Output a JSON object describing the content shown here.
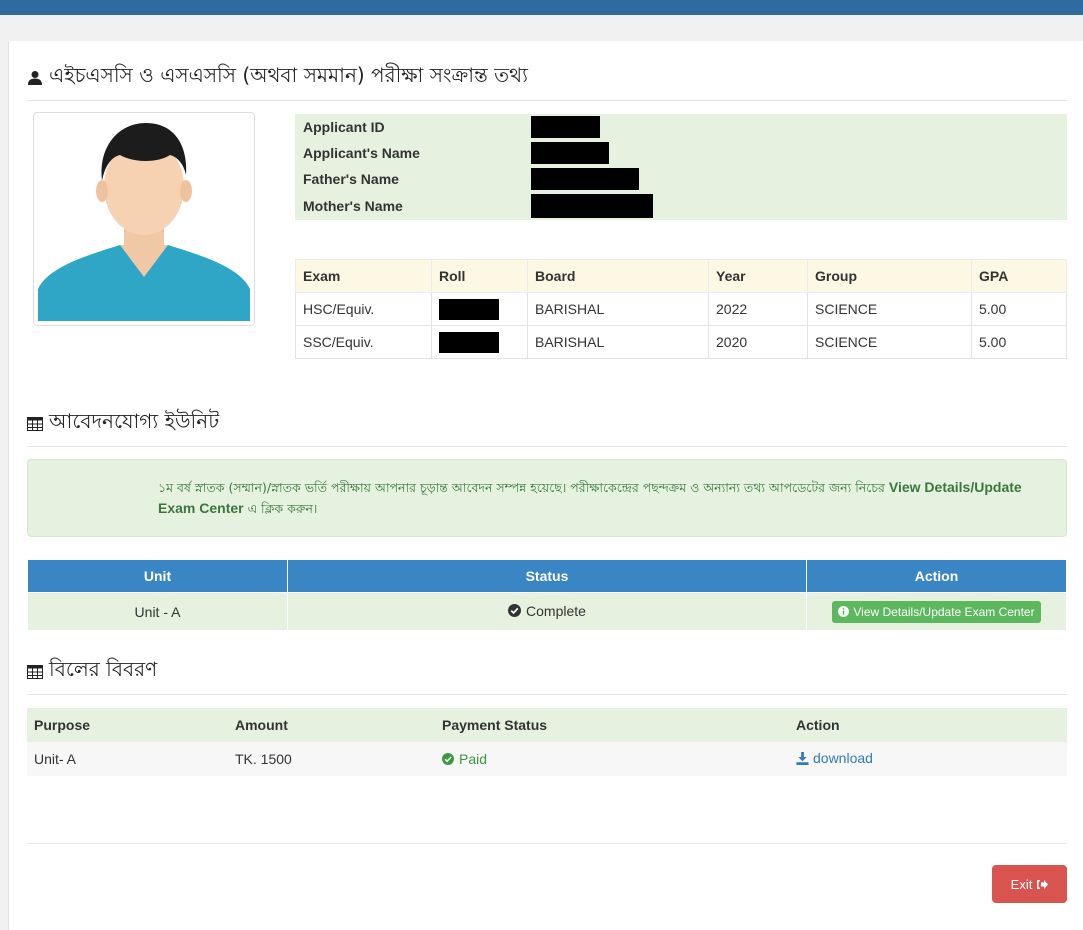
{
  "header": {
    "color": "#2f6aa0"
  },
  "sections": {
    "exam_info_title": "এইচএসসি ও এসএসসি (অথবা সমমান) পরীক্ষা সংক্রান্ত তথ্য",
    "units_title": "আবেদনযোগ্য ইউনিট",
    "bill_title": "বিলের বিবরণ"
  },
  "applicant": {
    "labels": {
      "id": "Applicant ID",
      "name": "Applicant's Name",
      "father": "Father's Name",
      "mother": "Mother's Name"
    }
  },
  "exam_table": {
    "headers": [
      "Exam",
      "Roll",
      "Board",
      "Year",
      "Group",
      "GPA"
    ],
    "rows": [
      {
        "exam": "HSC/Equiv.",
        "board": "BARISHAL",
        "year": "2022",
        "group": "SCIENCE",
        "gpa": "5.00"
      },
      {
        "exam": "SSC/Equiv.",
        "board": "BARISHAL",
        "year": "2020",
        "group": "SCIENCE",
        "gpa": "5.00"
      }
    ]
  },
  "alert": {
    "text_before": "১ম বর্ষ স্নাতক (সম্মান)/স্নাতক ভর্তি পরীক্ষায় আপনার চূড়ান্ত আবেদন সম্পন্ন হয়েছে। পরীক্ষাকেন্দ্রের পছন্দক্রম ও অন্যান্য তথ্য আপডেটের জন্য নিচের",
    "link_text": "View Details/Update Exam Center",
    "text_after": "এ ক্লিক করুন।"
  },
  "unit_table": {
    "headers": [
      "Unit",
      "Status",
      "Action"
    ],
    "rows": [
      {
        "unit": "Unit - A",
        "status": "Complete",
        "action": "View Details/Update Exam Center"
      }
    ]
  },
  "bill_table": {
    "headers": [
      "Purpose",
      "Amount",
      "Payment Status",
      "Action"
    ],
    "rows": [
      {
        "purpose": "Unit- A",
        "amount": "TK. 1500",
        "status": "Paid",
        "action": "download"
      }
    ]
  },
  "exit_label": "Exit",
  "icons": {
    "user": "user-icon",
    "table": "table-icon",
    "check": "check-circle-icon",
    "info": "info-circle-icon",
    "download": "download-icon",
    "signout": "sign-out-icon"
  },
  "colors": {
    "primary": "#3a86c5",
    "success": "#5cb85c",
    "danger": "#d9534f",
    "info_bg": "#e6f2df"
  }
}
